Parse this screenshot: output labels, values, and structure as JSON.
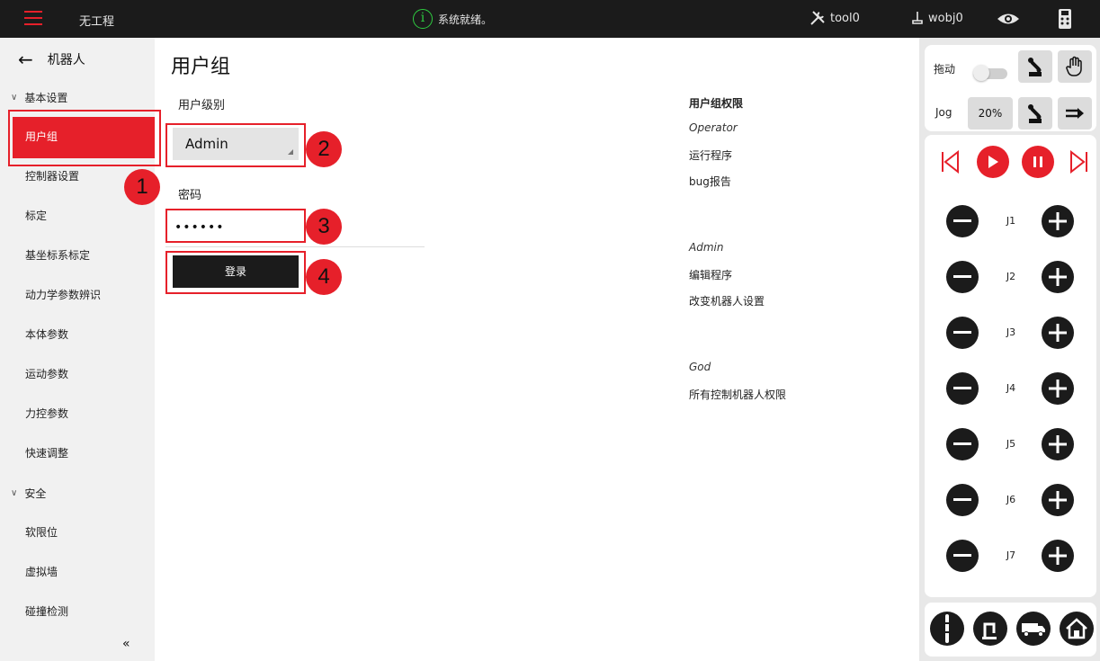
{
  "topbar": {
    "project": "无工程",
    "status": "系统就绪。",
    "tool": "tool0",
    "wobj": "wobj0"
  },
  "sidebar": {
    "back_label": "机器人",
    "group_basic": "基本设置",
    "items_basic": [
      "用户组",
      "控制器设置",
      "标定",
      "基坐标系标定",
      "动力学参数辨识",
      "本体参数",
      "运动参数",
      "力控参数",
      "快速调整"
    ],
    "group_safety": "安全",
    "items_safety": [
      "软限位",
      "虚拟墙",
      "碰撞检测"
    ],
    "collapse": "«"
  },
  "main": {
    "title": "用户组",
    "level_label": "用户级别",
    "level_value": "Admin",
    "password_label": "密码",
    "password_value": "••••••",
    "login_label": "登录"
  },
  "permissions": {
    "heading": "用户组权限",
    "operator": "Operator",
    "operator_items": [
      "运行程序",
      "bug报告"
    ],
    "admin": "Admin",
    "admin_items": [
      "编辑程序",
      "改变机器人设置"
    ],
    "god": "God",
    "god_items": [
      "所有控制机器人权限"
    ]
  },
  "annotations": [
    "1",
    "2",
    "3",
    "4"
  ],
  "right": {
    "drag_label": "拖动",
    "jog_label": "Jog",
    "speed": "20%",
    "joints": [
      "J1",
      "J2",
      "J3",
      "J4",
      "J5",
      "J6",
      "J7"
    ]
  },
  "colors": {
    "accent": "#e6202a",
    "dark": "#1b1b1b",
    "status_ok": "#2ecc40"
  }
}
